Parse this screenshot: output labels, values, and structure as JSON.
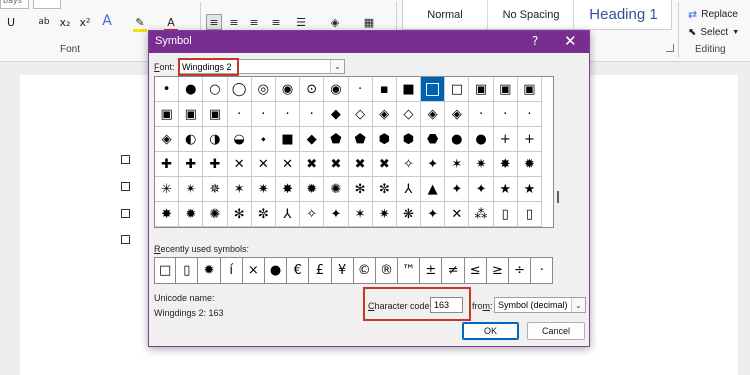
{
  "ribbon": {
    "font_group_label": "Font",
    "font_partial": "bays",
    "font_buttons": [
      "U",
      "ab",
      "x₂",
      "x²",
      "A",
      "✎",
      "A"
    ],
    "para_icons": [
      "≡",
      "≡",
      "≡",
      "≡",
      "☰",
      "◈",
      "▦"
    ],
    "styles": [
      "Normal",
      "No Spacing",
      "Heading 1"
    ],
    "editing": {
      "replace": "Replace",
      "select": "Select",
      "label": "Editing"
    }
  },
  "dialog": {
    "title": "Symbol",
    "help": "?",
    "close": "✕",
    "font_label": "Font:",
    "font_value": "Wingdings 2",
    "symbol_rows": [
      [
        "•",
        "●",
        "○",
        "◯",
        "◎",
        "◉",
        "⊙",
        "◉",
        "·",
        "▪",
        "■",
        "■",
        "□",
        "▣",
        "▣",
        "▣",
        "◉",
        "◎"
      ],
      [
        "▣",
        "▣",
        "▣",
        "·",
        "·",
        "·",
        "·",
        "◆",
        "◇",
        "◈",
        "◇",
        "◈",
        "◈",
        "·",
        "·",
        "·",
        "◆",
        "◇"
      ],
      [
        "◈",
        "◐",
        "◑",
        "◒",
        "⬩",
        "■",
        "◆",
        "⬟",
        "⬟",
        "⬢",
        "⬢",
        "⬣",
        "●",
        "●",
        "+",
        "+",
        "✚",
        "✚"
      ],
      [
        "✚",
        "✚",
        "✚",
        "✕",
        "✕",
        "✕",
        "✖",
        "✖",
        "✖",
        "✖",
        "✧",
        "✦",
        "✶",
        "✷",
        "✸",
        "✹",
        "✺",
        "✳"
      ],
      [
        "✳",
        "✴",
        "✵",
        "✶",
        "✷",
        "✸",
        "✹",
        "✺",
        "✻",
        "✼",
        "⅄",
        "▲",
        "✦",
        "✦",
        "★",
        "★",
        "★",
        "✷"
      ],
      [
        "✸",
        "✹",
        "✺",
        "✻",
        "✼",
        "⅄",
        "✧",
        "✦",
        "✶",
        "✷",
        "❋",
        "✦",
        "✕",
        "⁂",
        "▯",
        "▯",
        "▯",
        "▯"
      ]
    ],
    "recently_label": "Recently used symbols:",
    "recent_symbols": [
      "□",
      "▯",
      "✹",
      "í",
      "×",
      "●",
      "€",
      "£",
      "¥",
      "©",
      "®",
      "™",
      "±",
      "≠",
      "≤",
      "≥",
      "÷",
      "·"
    ],
    "unicode_name_label": "Unicode name:",
    "unicode_name_value": "Wingdings 2: 163",
    "char_code_label": "Character code:",
    "char_code_value": "163",
    "from_label": "from:",
    "from_value": "Symbol (decimal)",
    "ok": "OK",
    "cancel": "Cancel"
  },
  "colors": {
    "titlebar": "#772e8f",
    "highlight_box": "#c0392b",
    "selected_cell": "#0063b1",
    "heading": "#2f5597"
  }
}
